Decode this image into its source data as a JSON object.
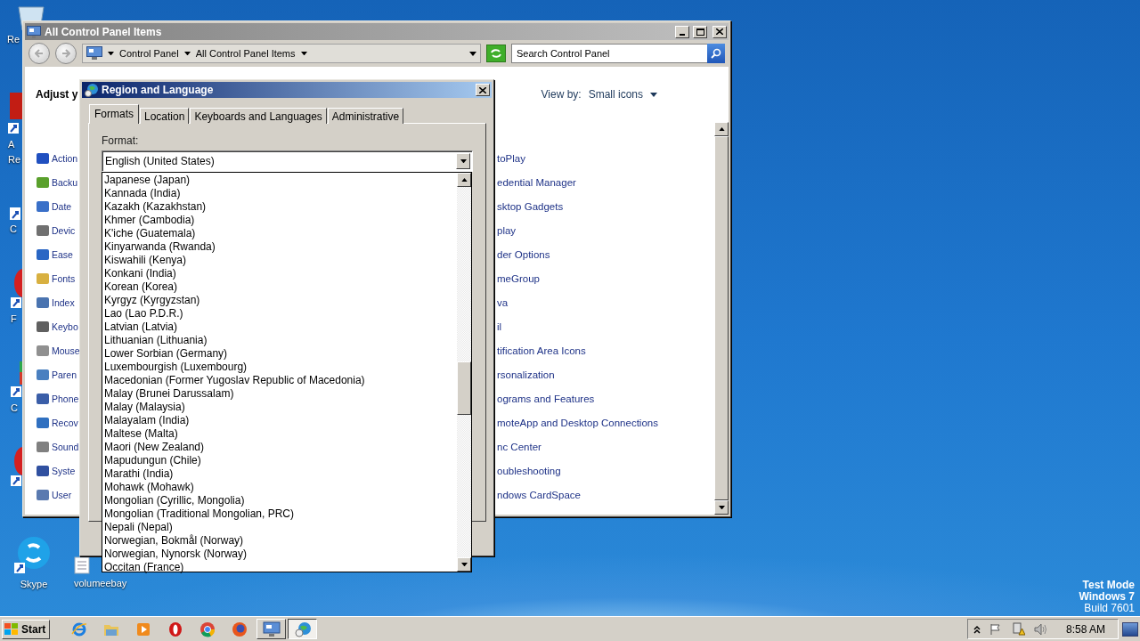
{
  "desktop_icons": [
    {
      "kind": "bin",
      "lines": [
        "Re"
      ]
    },
    {
      "kind": "red-app",
      "lines": [
        "A",
        "Re"
      ]
    },
    {
      "kind": "shortcut",
      "lines": [
        "C"
      ]
    },
    {
      "kind": "red-round",
      "lines": [
        "F"
      ]
    },
    {
      "kind": "green-app",
      "lines": [
        "C"
      ]
    },
    {
      "kind": "red-round"
    },
    {
      "kind": "skype",
      "lines": [
        "Skype"
      ]
    },
    {
      "kind": "document",
      "lines": [
        "volumeebay"
      ]
    }
  ],
  "control_panel": {
    "title": "All Control Panel Items",
    "breadcrumb": [
      "Control Panel",
      "All Control Panel Items"
    ],
    "search": {
      "placeholder": "Search Control Panel"
    },
    "heading": "Adjust y",
    "view_by": {
      "label": "View by:",
      "value": "Small icons"
    },
    "left_items": [
      "Action",
      "Backu",
      "Date",
      "Devic",
      "Ease",
      "Fonts",
      "Index",
      "Keybo",
      "Mouse",
      "Paren",
      "Phone",
      "Recov",
      "Sound",
      "Syste",
      "User"
    ],
    "right_items": [
      "toPlay",
      "edential Manager",
      "sktop Gadgets",
      "play",
      "der Options",
      "meGroup",
      "va",
      "il",
      "tification Area Icons",
      "rsonalization",
      "ograms and Features",
      "moteApp and Desktop Connections",
      "nc Center",
      "oubleshooting",
      "ndows CardSpace"
    ]
  },
  "dialog": {
    "title": "Region and Language",
    "tabs": [
      {
        "label": "Formats",
        "selected": true
      },
      {
        "label": "Location",
        "selected": false
      },
      {
        "label": "Keyboards and Languages",
        "selected": false
      },
      {
        "label": "Administrative",
        "selected": false
      }
    ],
    "format": {
      "label": "Format:",
      "value": "English (United States)",
      "expanded": true,
      "options": [
        "Japanese (Japan)",
        "Kannada (India)",
        "Kazakh (Kazakhstan)",
        "Khmer (Cambodia)",
        "K'iche (Guatemala)",
        "Kinyarwanda (Rwanda)",
        "Kiswahili (Kenya)",
        "Konkani (India)",
        "Korean (Korea)",
        "Kyrgyz (Kyrgyzstan)",
        "Lao (Lao P.D.R.)",
        "Latvian (Latvia)",
        "Lithuanian (Lithuania)",
        "Lower Sorbian (Germany)",
        "Luxembourgish (Luxembourg)",
        "Macedonian (Former Yugoslav Republic of Macedonia)",
        "Malay (Brunei Darussalam)",
        "Malay (Malaysia)",
        "Malayalam (India)",
        "Maltese (Malta)",
        "Maori (New Zealand)",
        "Mapudungun (Chile)",
        "Marathi (India)",
        "Mohawk (Mohawk)",
        "Mongolian (Cyrillic, Mongolia)",
        "Mongolian (Traditional Mongolian, PRC)",
        "Nepali (Nepal)",
        "Norwegian, Bokmål (Norway)",
        "Norwegian, Nynorsk (Norway)",
        "Occitan (France)"
      ]
    }
  },
  "os_notice": [
    "Test Mode",
    "Windows 7",
    "Build 7601"
  ],
  "taskbar": {
    "start": "Start",
    "apps": [
      {
        "kind": "ie",
        "open": false,
        "selected": false
      },
      {
        "kind": "folder",
        "open": false,
        "selected": false
      },
      {
        "kind": "media",
        "open": false,
        "selected": false
      },
      {
        "kind": "opera",
        "open": false,
        "selected": false
      },
      {
        "kind": "chrome",
        "open": false,
        "selected": false
      },
      {
        "kind": "firefox",
        "open": false,
        "selected": false
      },
      {
        "kind": "control-panel",
        "open": true,
        "selected": false
      },
      {
        "kind": "region",
        "open": true,
        "selected": true
      }
    ],
    "time": "8:58 AM"
  }
}
